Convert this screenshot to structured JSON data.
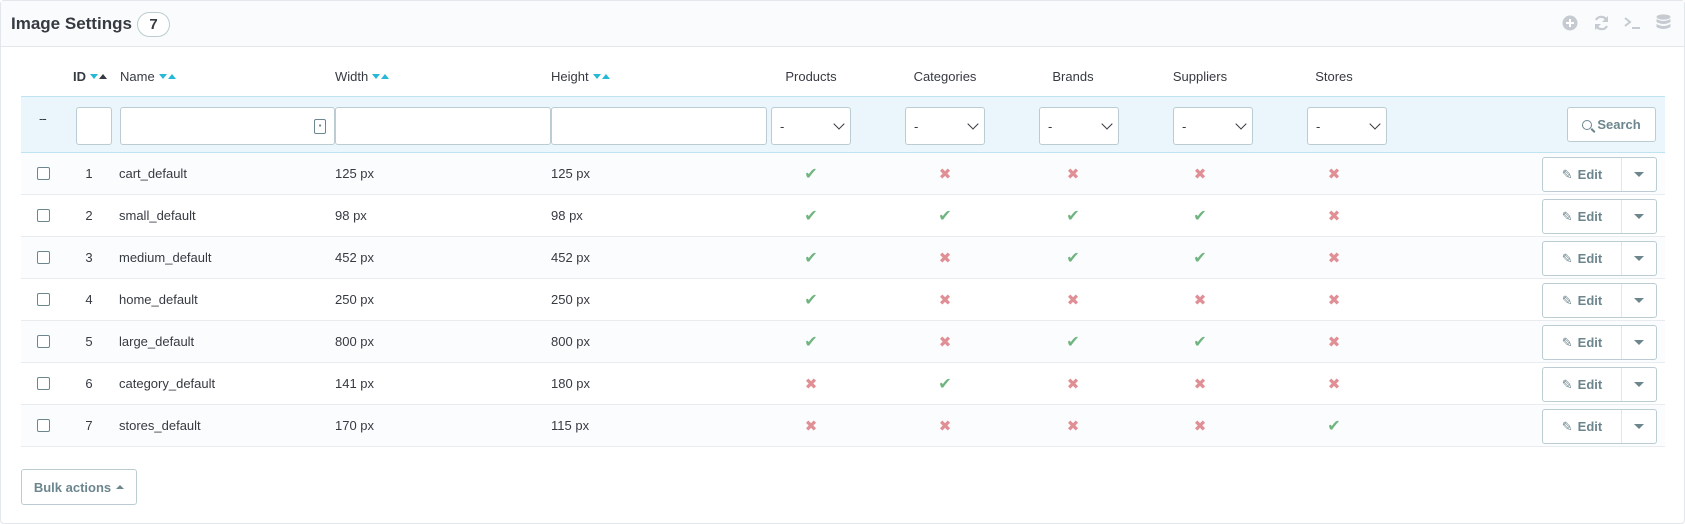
{
  "panel": {
    "title": "Image Settings",
    "count": "7"
  },
  "toolbar": {
    "icons": [
      "add-icon",
      "refresh-icon",
      "terminal-icon",
      "database-icon"
    ]
  },
  "columns": {
    "id": "ID",
    "name": "Name",
    "width": "Width",
    "height": "Height",
    "products": "Products",
    "categories": "Categories",
    "brands": "Brands",
    "suppliers": "Suppliers",
    "stores": "Stores"
  },
  "filters": {
    "dashdash": "--",
    "select_value": "-",
    "search_label": "Search"
  },
  "rows": [
    {
      "id": "1",
      "name": "cart_default",
      "width": "125 px",
      "height": "125 px",
      "products": true,
      "categories": false,
      "brands": false,
      "suppliers": false,
      "stores": false
    },
    {
      "id": "2",
      "name": "small_default",
      "width": "98 px",
      "height": "98 px",
      "products": true,
      "categories": true,
      "brands": true,
      "suppliers": true,
      "stores": false
    },
    {
      "id": "3",
      "name": "medium_default",
      "width": "452 px",
      "height": "452 px",
      "products": true,
      "categories": false,
      "brands": true,
      "suppliers": true,
      "stores": false
    },
    {
      "id": "4",
      "name": "home_default",
      "width": "250 px",
      "height": "250 px",
      "products": true,
      "categories": false,
      "brands": false,
      "suppliers": false,
      "stores": false
    },
    {
      "id": "5",
      "name": "large_default",
      "width": "800 px",
      "height": "800 px",
      "products": true,
      "categories": false,
      "brands": true,
      "suppliers": true,
      "stores": false
    },
    {
      "id": "6",
      "name": "category_default",
      "width": "141 px",
      "height": "180 px",
      "products": false,
      "categories": true,
      "brands": false,
      "suppliers": false,
      "stores": false
    },
    {
      "id": "7",
      "name": "stores_default",
      "width": "170 px",
      "height": "115 px",
      "products": false,
      "categories": false,
      "brands": false,
      "suppliers": false,
      "stores": true
    }
  ],
  "row_actions": {
    "edit_label": "Edit"
  },
  "bulk_actions": {
    "label": "Bulk actions"
  },
  "symbols": {
    "check": "✔",
    "cross": "✖"
  },
  "colors": {
    "accent": "#25b9d7",
    "check": "#70b580",
    "cross": "#e08f95",
    "filter_bg": "#eaf6fc"
  }
}
